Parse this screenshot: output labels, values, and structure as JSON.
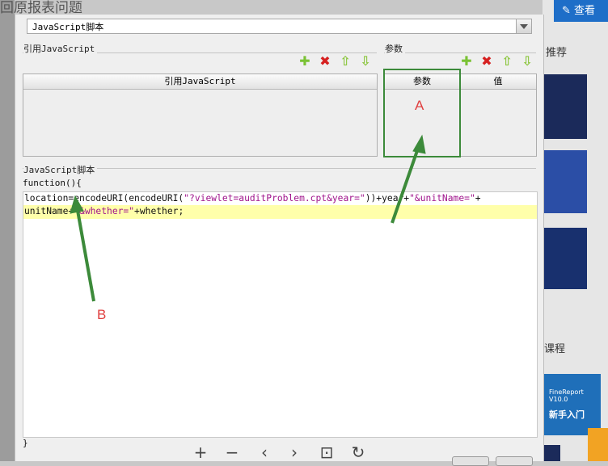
{
  "background": {
    "page_title_partial": "回原报表问题",
    "view_button": "查看",
    "recommend": "推荐",
    "course": "课程",
    "fr_label": "FineReport V10.0",
    "fr_title": "新手入门"
  },
  "dialog": {
    "script_type_select": "JavaScript脚本",
    "ref_section_label": "引用JavaScript",
    "param_section_label": "参数",
    "ref_table_header": "引用JavaScript",
    "param_table_headers": [
      "参数",
      "值"
    ],
    "script_section_label": "JavaScript脚本",
    "function_open": "function(){",
    "function_close": "}"
  },
  "code": {
    "line1_pre": "location=encodeURI(encodeURI(",
    "line1_str1": "\"?viewlet=auditProblem.cpt&year=\"",
    "line1_mid": "))+year+",
    "line1_str2": "\"&unitName=\"",
    "line1_end": "+",
    "line2_pre": "unitName+",
    "line2_str": "\"&whether=\"",
    "line2_end": "+whether;"
  },
  "annotations": {
    "a": "A",
    "b": "B"
  },
  "colors": {
    "annotation_green": "#3c8a3a",
    "annotation_red": "#e04040",
    "highlight_line": "#ffffaa"
  }
}
